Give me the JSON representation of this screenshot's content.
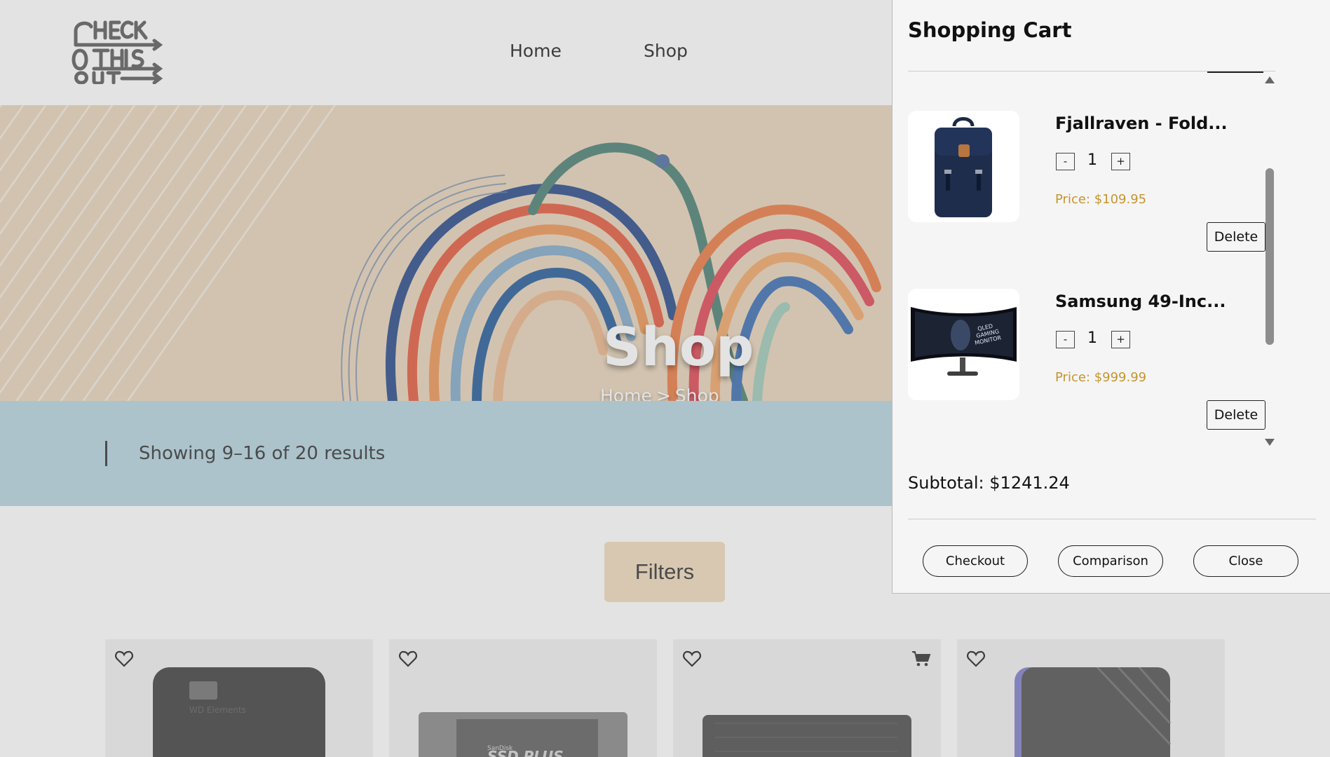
{
  "header": {
    "logo_text": "CHECK THIS OUT",
    "nav": [
      {
        "label": "Home"
      },
      {
        "label": "Shop"
      }
    ]
  },
  "hero": {
    "title": "Shop",
    "breadcrumb": [
      "Home",
      "Shop"
    ],
    "separator": ">"
  },
  "results": {
    "text": "Showing 9–16 of 20 results"
  },
  "filters": {
    "label": "Filters"
  },
  "product_grid": {
    "cards": [
      {
        "icon": "heart-icon",
        "image": "wd-elements-drive"
      },
      {
        "icon": "heart-icon",
        "image": "sandisk-ssd-plus"
      },
      {
        "icon": "heart-icon",
        "image": "gray-ssd",
        "extra_icon": "cart-icon"
      },
      {
        "icon": "heart-icon",
        "image": "external-drive"
      }
    ]
  },
  "cart": {
    "title": "Shopping Cart",
    "items": [
      {
        "name": "Fjallraven - Fold...",
        "quantity": "1",
        "minus": "-",
        "plus": "+",
        "price": "Price: $109.95",
        "delete_label": "Delete",
        "image": "backpack"
      },
      {
        "name": "Samsung 49-Inc...",
        "quantity": "1",
        "minus": "-",
        "plus": "+",
        "price": "Price: $999.99",
        "delete_label": "Delete",
        "image": "curved-monitor"
      }
    ],
    "subtotal": "Subtotal: $1241.24",
    "actions": {
      "checkout": "Checkout",
      "comparison": "Comparison",
      "close": "Close"
    }
  },
  "colors": {
    "price": "#c5962e",
    "results_bar": "#c2dce6",
    "filters_bg": "#f3e1c7",
    "panel_bg": "#f5f5f5"
  }
}
